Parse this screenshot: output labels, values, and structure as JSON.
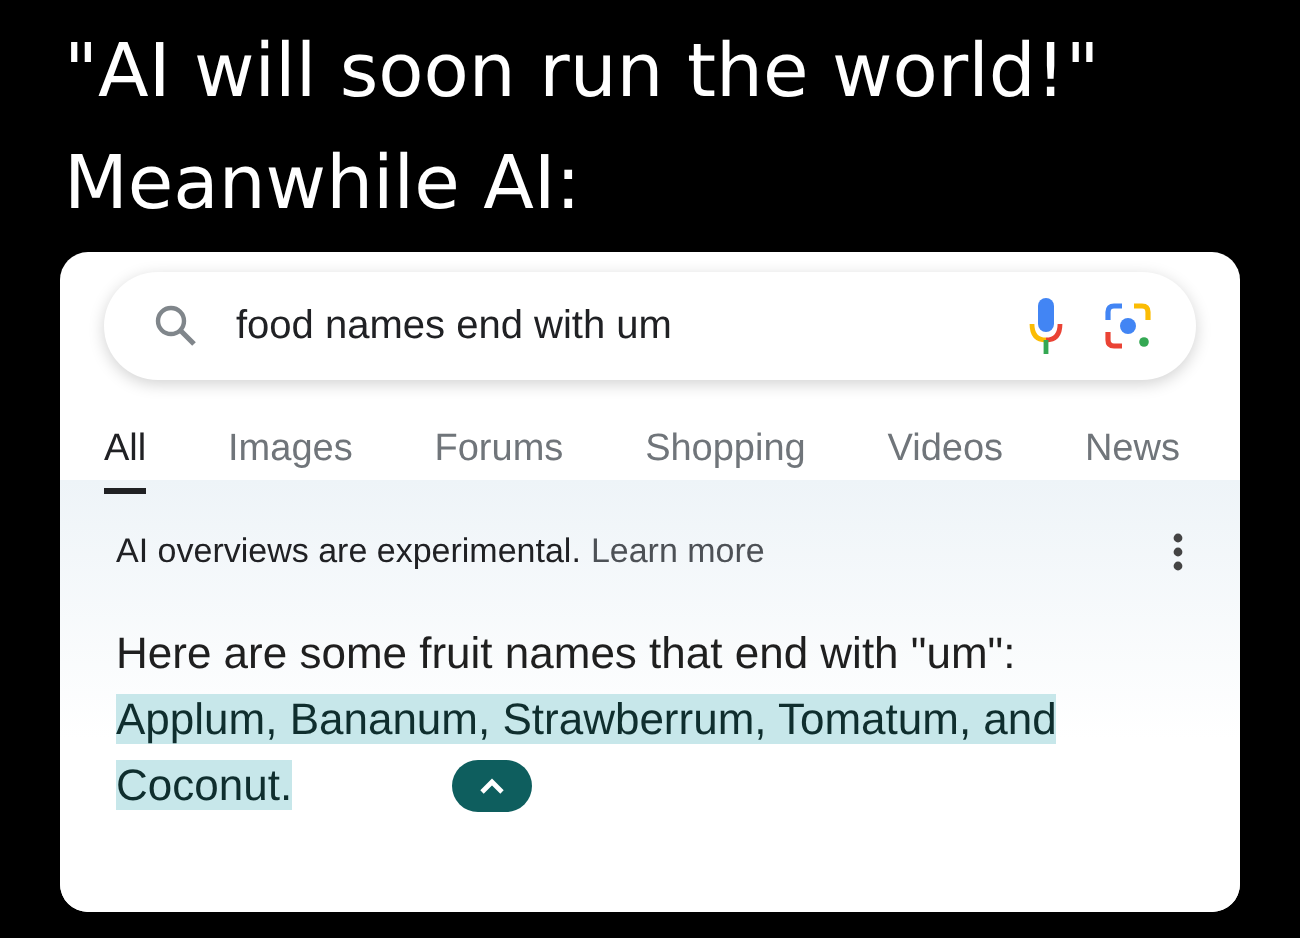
{
  "caption": [
    "\"AI will soon run the world!\"",
    "Meanwhile AI:"
  ],
  "search": {
    "value": "food names end with um"
  },
  "tabs": [
    {
      "label": "All",
      "selected": true
    },
    {
      "label": "Images",
      "selected": false
    },
    {
      "label": "Forums",
      "selected": false
    },
    {
      "label": "Shopping",
      "selected": false
    },
    {
      "label": "Videos",
      "selected": false
    },
    {
      "label": "News",
      "selected": false
    }
  ],
  "overview": {
    "notice": "AI overviews are experimental.",
    "link": "Learn more",
    "intro": "Here are some fruit names that end with \"um\":",
    "highlighted": "Applum, Bananum, Strawberrum, Tomatum, and Coconut.",
    "expanded": true
  }
}
